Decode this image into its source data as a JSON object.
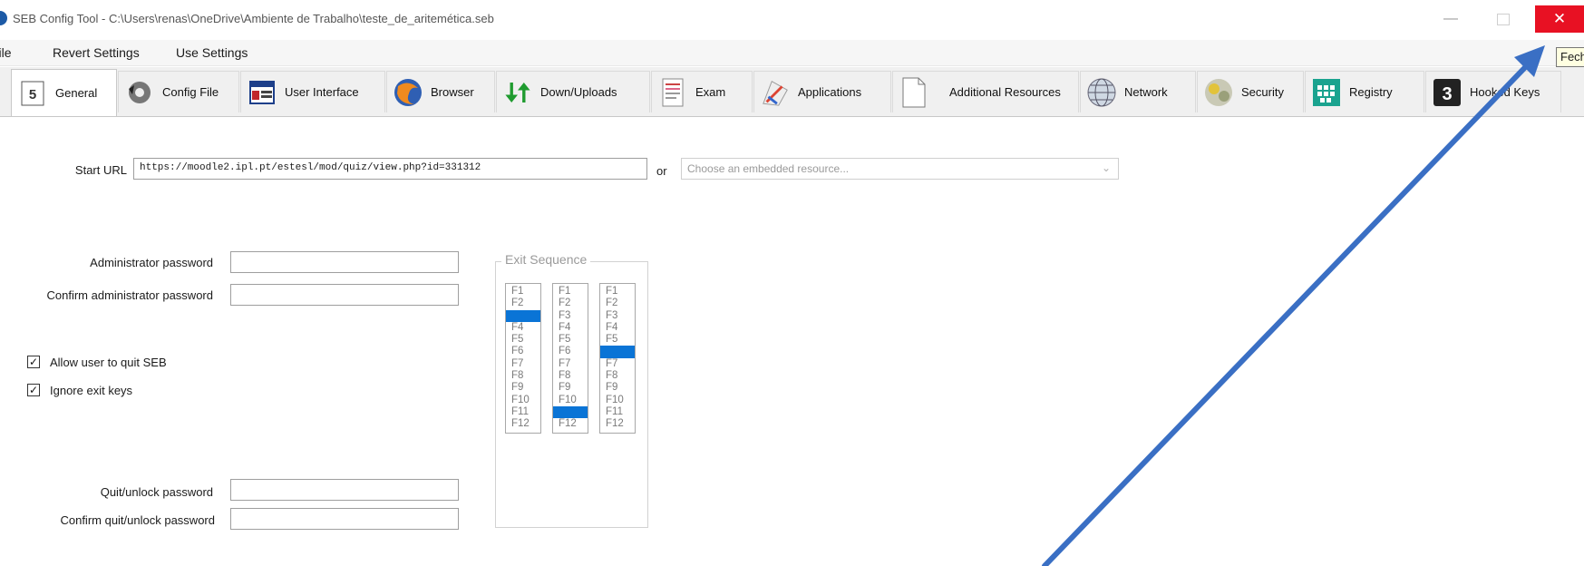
{
  "window": {
    "title": "SEB Config Tool - C:\\Users\\renas\\OneDrive\\Ambiente de Trabalho\\teste_de_aritemética.seb",
    "minimize_glyph": "—",
    "close_glyph": "✕",
    "tooltip": "Fech",
    "close_color": "#e81123"
  },
  "menu": [
    {
      "label": "File"
    },
    {
      "label": "Revert Settings"
    },
    {
      "label": "Use Settings"
    }
  ],
  "tabs": [
    {
      "label": "General",
      "icon": "general-icon",
      "glyph": "5"
    },
    {
      "label": "Config File",
      "icon": "config-file-icon"
    },
    {
      "label": "User Interface",
      "icon": "user-interface-icon"
    },
    {
      "label": "Browser",
      "icon": "browser-icon"
    },
    {
      "label": "Down/Uploads",
      "icon": "down-uploads-icon"
    },
    {
      "label": "Exam",
      "icon": "exam-icon"
    },
    {
      "label": "Applications",
      "icon": "applications-icon"
    },
    {
      "label": "Additional Resources",
      "icon": "additional-resources-icon"
    },
    {
      "label": "Network",
      "icon": "network-icon"
    },
    {
      "label": "Security",
      "icon": "security-icon"
    },
    {
      "label": "Registry",
      "icon": "registry-icon"
    },
    {
      "label": "Hooked Keys",
      "icon": "hooked-keys-icon",
      "glyph": "3"
    }
  ],
  "general": {
    "start_url_label": "Start URL",
    "start_url_value": "https://moodle2.ipl.pt/estesl/mod/quiz/view.php?id=331312",
    "or_label": "or",
    "embedded_resource_placeholder": "Choose an embedded resource...",
    "admin_password_label": "Administrator password",
    "confirm_admin_password_label": "Confirm administrator password",
    "allow_quit_label": "Allow user to quit SEB",
    "allow_quit_checked": true,
    "ignore_exit_keys_label": "Ignore exit keys",
    "ignore_exit_keys_checked": true,
    "quit_password_label": "Quit/unlock password",
    "confirm_quit_password_label": "Confirm quit/unlock password",
    "check_glyph": "✓"
  },
  "exit_sequence": {
    "title": "Exit Sequence",
    "keys": [
      "F1",
      "F2",
      "F3",
      "F4",
      "F5",
      "F6",
      "F7",
      "F8",
      "F9",
      "F10",
      "F11",
      "F12"
    ],
    "selected": [
      "F3",
      "F11",
      "F6"
    ]
  },
  "colors": {
    "selection": "#0a74d6",
    "arrow": "#3a6fc4"
  }
}
